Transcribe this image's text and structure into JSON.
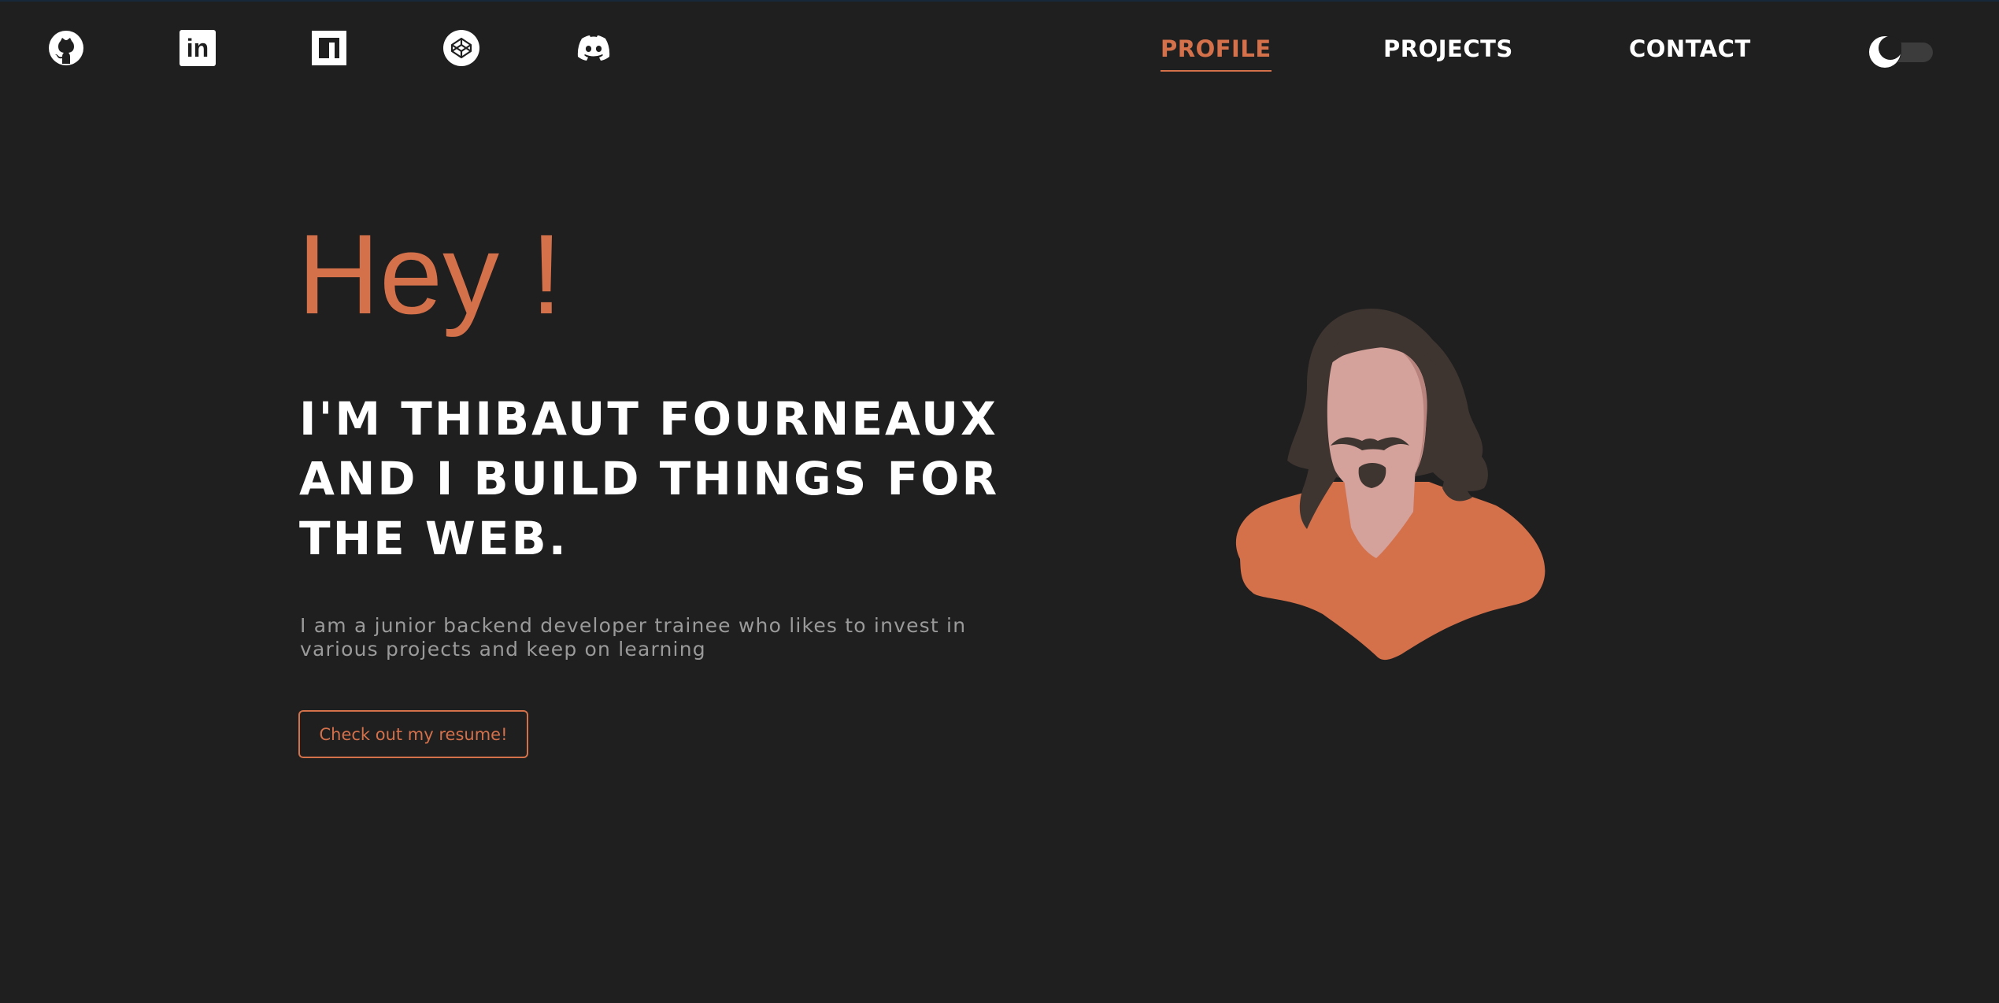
{
  "socials": [
    {
      "name": "github",
      "icon": "github-icon"
    },
    {
      "name": "linkedin",
      "icon": "linkedin-icon",
      "glyph": "in"
    },
    {
      "name": "npm",
      "icon": "npm-icon"
    },
    {
      "name": "codepen",
      "icon": "codepen-icon"
    },
    {
      "name": "discord",
      "icon": "discord-icon"
    }
  ],
  "nav": {
    "profile": "PROFILE",
    "projects": "PROJECTS",
    "contact": "CONTACT",
    "active": "profile"
  },
  "theme_toggle": {
    "icon": "moon-icon",
    "state": "dark"
  },
  "hero": {
    "greeting": "Hey !",
    "headline_line1": "I'M THIBAUT FOURNEAUX",
    "headline_line2": "AND I BUILD THINGS FOR",
    "headline_line3": "THE WEB.",
    "intro_line1": "I am a junior backend developer trainee who likes to invest in",
    "intro_line2": "various projects and keep on learning",
    "resume_button": "Check out my resume!"
  },
  "avatar": {
    "icon": "avatar-illustration"
  },
  "colors": {
    "background": "#1f1f1f",
    "accent": "#d4704a",
    "text": "#ffffff",
    "muted_text": "#9a9a9a",
    "hair": "#3e3430",
    "skin": "#d4a19b",
    "shirt": "#d4704a"
  }
}
